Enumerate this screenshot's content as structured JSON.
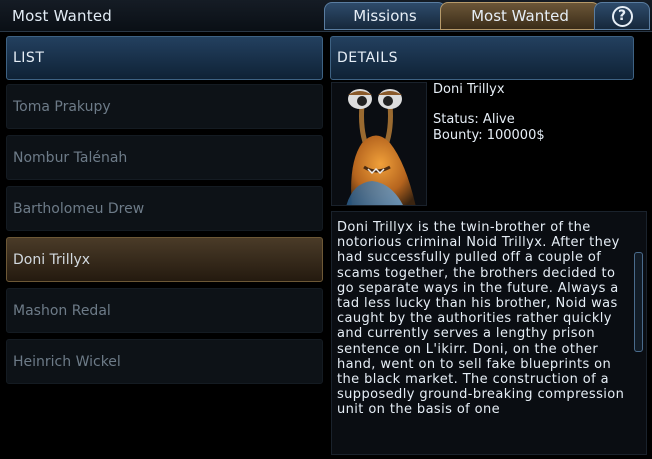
{
  "window": {
    "title": "Most Wanted"
  },
  "tabs": [
    {
      "label": "Missions"
    },
    {
      "label": "Most Wanted"
    },
    {
      "label": "?"
    }
  ],
  "list": {
    "header": "LIST",
    "items": [
      {
        "name": "Toma Prakupy"
      },
      {
        "name": "Nombur Talénah"
      },
      {
        "name": "Bartholomeu Drew"
      },
      {
        "name": "Doni Trillyx",
        "selected": true
      },
      {
        "name": "Mashon Redal"
      },
      {
        "name": "Heinrich Wickel"
      }
    ]
  },
  "details": {
    "header": "DETAILS",
    "name": "Doni Trillyx",
    "status": "Status: Alive",
    "bounty": "Bounty: 100000$",
    "description": "Doni Trillyx is the twin-brother of the notorious criminal Noid Trillyx. After they had successfully pulled off a couple of scams together, the brothers decided to go separate ways in the future. Always a tad less lucky than his brother, Noid was caught by the authorities rather quickly and currently serves a lengthy prison sentence on L'ikirr. Doni, on the other hand, went on to sell fake blueprints on the black market. The construction of a supposedly ground-breaking compression unit on the basis of one"
  }
}
